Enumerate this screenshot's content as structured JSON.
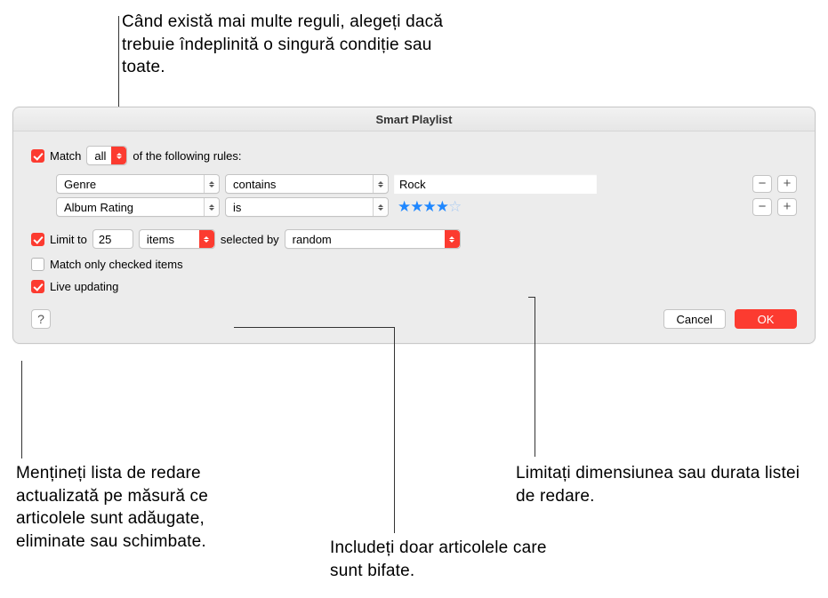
{
  "callouts": {
    "top": "Când există mai multe reguli, alegeți dacă trebuie îndeplinită o singură condiție sau toate.",
    "bottom_left": "Mențineți lista de redare actualizată pe măsură ce articolele sunt adăugate, eliminate sau schimbate.",
    "bottom_mid": "Includeți doar articolele care sunt bifate.",
    "bottom_right": "Limitați dimensiunea sau durata listei de redare."
  },
  "dialog": {
    "title": "Smart Playlist",
    "match_label_pre": "Match",
    "match_mode": "all",
    "match_label_post": "of the following rules:",
    "rules": [
      {
        "field": "Genre",
        "op": "contains",
        "value": "Rock",
        "value_type": "text"
      },
      {
        "field": "Album Rating",
        "op": "is",
        "value": 4,
        "value_type": "stars",
        "max_stars": 5
      }
    ],
    "limit": {
      "label": "Limit to",
      "count": "25",
      "unit": "items",
      "selected_by_label": "selected by",
      "method": "random"
    },
    "match_checked_label": "Match only checked items",
    "live_updating_label": "Live updating",
    "buttons": {
      "help": "?",
      "cancel": "Cancel",
      "ok": "OK"
    }
  },
  "checkbox_states": {
    "match": true,
    "limit": true,
    "match_checked": false,
    "live_updating": true
  }
}
